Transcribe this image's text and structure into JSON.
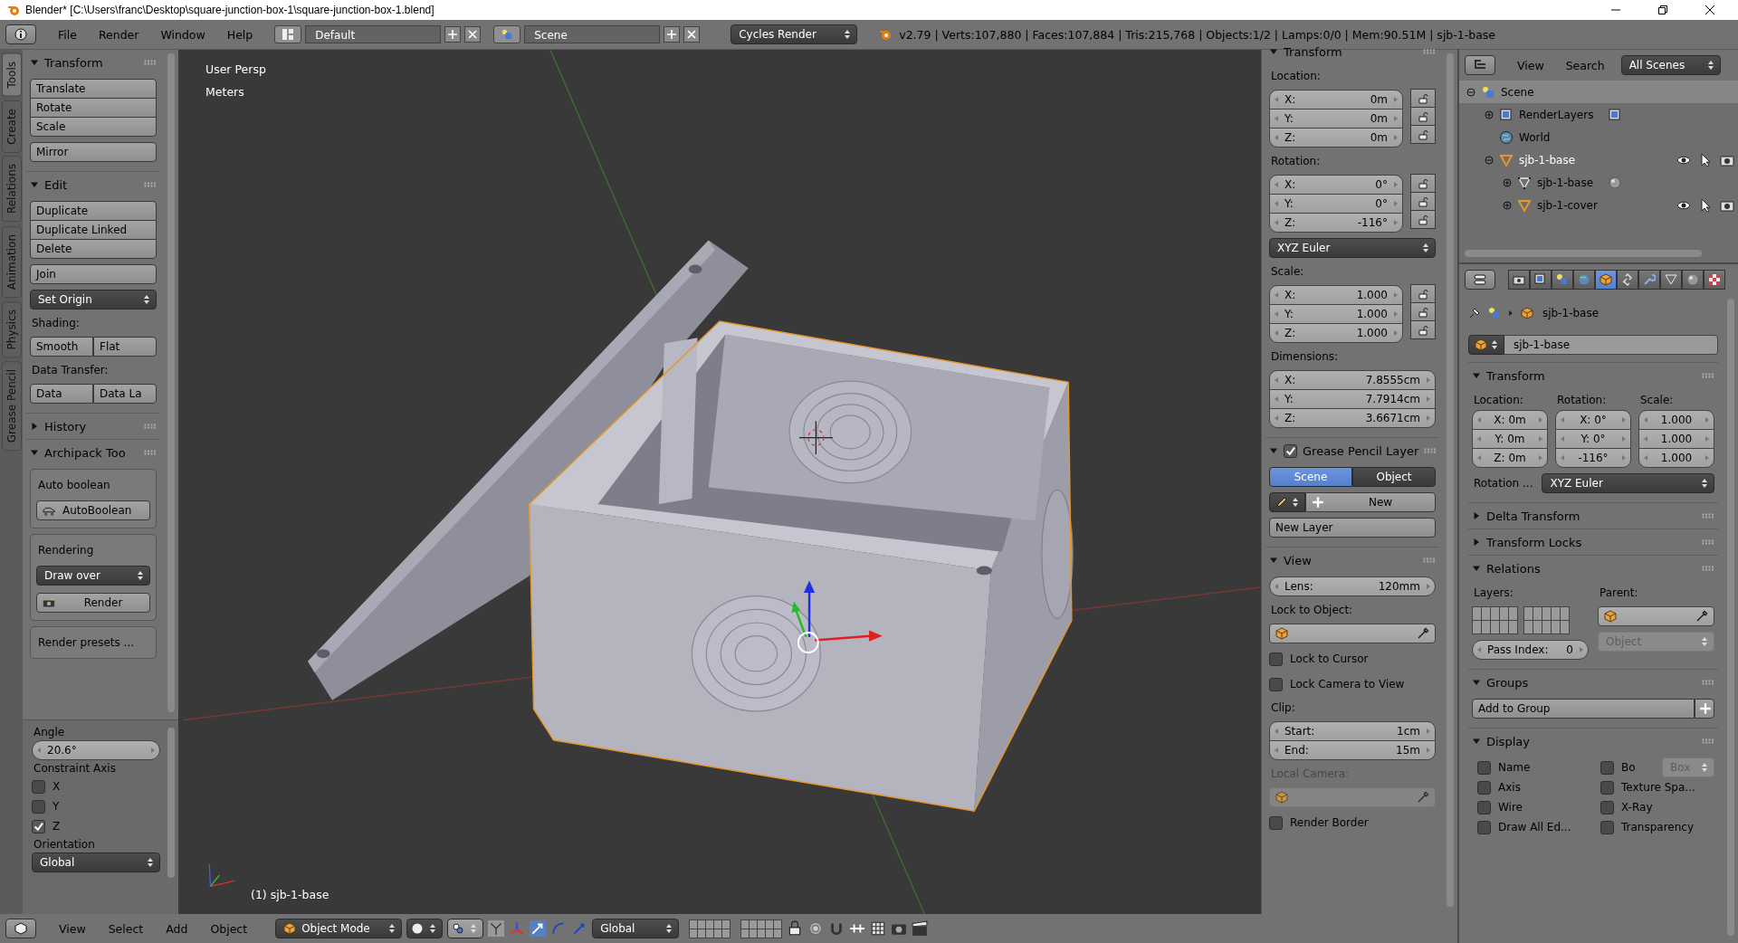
{
  "title_bar": {
    "title": "Blender* [C:\\Users\\franc\\Desktop\\square-junction-box-1\\square-junction-box-1.blend]"
  },
  "info_header": {
    "menus": [
      "File",
      "Render",
      "Window",
      "Help"
    ],
    "screen_layout": "Default",
    "scene": "Scene",
    "render_engine": "Cycles Render",
    "stats": "v2.79 | Verts:107,880 | Faces:107,884 | Tris:215,768 | Objects:1/2 | Lamps:0/0 | Mem:90.51M | sjb-1-base"
  },
  "tool_tabs": [
    {
      "label": "Tools",
      "selected": true
    },
    {
      "label": "Create",
      "selected": false
    },
    {
      "label": "Relations",
      "selected": false
    },
    {
      "label": "Animation",
      "selected": false
    },
    {
      "label": "Physics",
      "selected": false
    },
    {
      "label": "Grease Pencil",
      "selected": false
    }
  ],
  "tool_shelf": {
    "panels": [
      {
        "title": "Transform",
        "expanded": true,
        "items": [
          {
            "kind": "column",
            "labels": [
              "Translate",
              "Rotate",
              "Scale"
            ]
          },
          {
            "kind": "button",
            "label": "Mirror"
          }
        ]
      },
      {
        "title": "Edit",
        "expanded": true,
        "items": [
          {
            "kind": "column",
            "labels": [
              "Duplicate",
              "Duplicate Linked",
              "Delete"
            ]
          },
          {
            "kind": "button",
            "label": "Join"
          },
          {
            "kind": "dropdown",
            "value": "Set Origin",
            "disabled": false
          },
          {
            "kind": "label",
            "text": "Shading:",
            "disabled": false
          },
          {
            "kind": "row",
            "labels": [
              "Smooth",
              "Flat"
            ]
          },
          {
            "kind": "label",
            "text": "Data Transfer:",
            "disabled": false
          },
          {
            "kind": "row",
            "labels": [
              "Data",
              "Data La"
            ]
          }
        ]
      },
      {
        "title": "History",
        "expanded": false
      },
      {
        "title": "Archipack Too",
        "expanded": true,
        "items": [
          {
            "kind": "box",
            "items": [
              {
                "kind": "label",
                "text": "Auto boolean",
                "disabled": false
              },
              {
                "kind": "boolean_button",
                "label": "AutoBoolean"
              }
            ]
          },
          {
            "kind": "box",
            "items": [
              {
                "kind": "label",
                "text": "Rendering",
                "disabled": false
              },
              {
                "kind": "dropdown",
                "value": "Draw over",
                "disabled": false
              },
              {
                "kind": "render_button",
                "label": "Render"
              }
            ]
          },
          {
            "kind": "box",
            "items": [
              {
                "kind": "label",
                "text": "Render presets ...",
                "disabled": false
              }
            ]
          }
        ]
      }
    ]
  },
  "operator_panel": {
    "items": [
      {
        "kind": "label",
        "text": "Angle",
        "disabled": false
      },
      {
        "kind": "number",
        "value": "20.6°"
      },
      {
        "kind": "label",
        "text": "Constraint Axis",
        "disabled": false
      },
      {
        "kind": "checkbox",
        "label": "X",
        "checked": false
      },
      {
        "kind": "checkbox",
        "label": "Y",
        "checked": false
      },
      {
        "kind": "checkbox",
        "label": "Z",
        "checked": true
      },
      {
        "kind": "label",
        "text": "Orientation",
        "disabled": false
      },
      {
        "kind": "dropdown",
        "value": "Global",
        "disabled": false
      }
    ]
  },
  "viewport": {
    "view_name": "User Persp",
    "units": "Meters",
    "object_label": "(1) sjb-1-base"
  },
  "n_panel": {
    "panels": [
      {
        "title": "Transform",
        "expanded": true,
        "items": [
          {
            "kind": "label",
            "text": "Location:",
            "disabled": false
          },
          {
            "kind": "fields",
            "locks": true,
            "fields": [
              {
                "label": "X:",
                "value": "0m"
              },
              {
                "label": "Y:",
                "value": "0m"
              },
              {
                "label": "Z:",
                "value": "0m"
              }
            ]
          },
          {
            "kind": "label",
            "text": "Rotation:",
            "disabled": false
          },
          {
            "kind": "fields",
            "locks": true,
            "fields": [
              {
                "label": "X:",
                "value": "0°"
              },
              {
                "label": "Y:",
                "value": "0°"
              },
              {
                "label": "Z:",
                "value": "-116°"
              }
            ]
          },
          {
            "kind": "dropdown",
            "value": "XYZ Euler",
            "disabled": false
          },
          {
            "kind": "label",
            "text": "Scale:",
            "disabled": false
          },
          {
            "kind": "fields",
            "locks": true,
            "fields": [
              {
                "label": "X:",
                "value": "1.000"
              },
              {
                "label": "Y:",
                "value": "1.000"
              },
              {
                "label": "Z:",
                "value": "1.000"
              }
            ]
          },
          {
            "kind": "label",
            "text": "Dimensions:",
            "disabled": false
          },
          {
            "kind": "fields",
            "locks": false,
            "fields": [
              {
                "label": "X:",
                "value": "7.8555cm"
              },
              {
                "label": "Y:",
                "value": "7.7914cm"
              },
              {
                "label": "Z:",
                "value": "3.6671cm"
              }
            ]
          }
        ]
      },
      {
        "title": "Grease Pencil Layer",
        "expanded": true,
        "checked": true,
        "items": [
          {
            "kind": "segmented",
            "options": [
              {
                "label": "Scene",
                "selected": true
              },
              {
                "label": "Object",
                "selected": false
              }
            ]
          },
          {
            "kind": "pencil_new",
            "label": "New"
          },
          {
            "kind": "button",
            "label": "New Layer"
          }
        ]
      },
      {
        "title": "View",
        "expanded": true,
        "items": [
          {
            "kind": "number",
            "label": "Lens:",
            "value": "120mm"
          },
          {
            "kind": "label",
            "text": "Lock to Object:",
            "disabled": false
          },
          {
            "kind": "picker",
            "disabled": false
          },
          {
            "kind": "checkbox",
            "label": "Lock to Cursor",
            "checked": false
          },
          {
            "kind": "checkbox",
            "label": "Lock Camera to View",
            "checked": false
          },
          {
            "kind": "label",
            "text": "Clip:",
            "disabled": false
          },
          {
            "kind": "fields",
            "locks": false,
            "fields": [
              {
                "label": "Start:",
                "value": "1cm"
              },
              {
                "label": "End:",
                "value": "15m"
              }
            ]
          },
          {
            "kind": "label",
            "text": "Local Camera:",
            "disabled": true
          },
          {
            "kind": "picker",
            "disabled": true
          },
          {
            "kind": "checkbox",
            "label": "Render Border",
            "checked": false
          }
        ]
      }
    ]
  },
  "outliner": {
    "menus": [
      "View",
      "Search"
    ],
    "filter": "All Scenes",
    "tree": [
      {
        "name": "Scene",
        "kind": "scene",
        "expanded": true,
        "selected": true,
        "active": false,
        "toggles": false,
        "children": [
          {
            "name": "RenderLayers",
            "kind": "renderlayers",
            "expanded": false,
            "selected": false,
            "active": false,
            "toggles": false
          },
          {
            "name": "World",
            "kind": "world",
            "selected": false,
            "active": false,
            "toggles": false
          },
          {
            "name": "sjb-1-base",
            "kind": "object",
            "expanded": true,
            "selected": false,
            "active": true,
            "toggles": true,
            "children": [
              {
                "name": "sjb-1-base",
                "kind": "mesh",
                "expanded": false,
                "selected": false,
                "active": false,
                "toggles": false
              },
              {
                "name": "sjb-1-cover",
                "kind": "object",
                "expanded": false,
                "selected": false,
                "active": false,
                "toggles": true
              }
            ]
          }
        ]
      }
    ]
  },
  "properties": {
    "tabs": [
      {
        "kind": "render",
        "selected": false
      },
      {
        "kind": "render_layers",
        "selected": false
      },
      {
        "kind": "scene",
        "selected": false
      },
      {
        "kind": "world",
        "selected": false
      },
      {
        "kind": "object",
        "selected": true
      },
      {
        "kind": "constraints",
        "selected": false
      },
      {
        "kind": "modifiers",
        "selected": false
      },
      {
        "kind": "data",
        "selected": false
      },
      {
        "kind": "material",
        "selected": false
      },
      {
        "kind": "texture",
        "selected": false
      }
    ],
    "breadcrumb": "sjb-1-base",
    "object_name": "sjb-1-base",
    "panels": [
      {
        "title": "Transform",
        "expanded": true,
        "items": [
          {
            "kind": "columns",
            "columns": [
              {
                "label": "Location:",
                "fields": [
                  "X: 0m",
                  "Y: 0m",
                  "Z: 0m"
                ]
              },
              {
                "label": "Rotation:",
                "fields": [
                  "X:  0°",
                  "Y:  0°",
                  "-116°"
                ]
              },
              {
                "label": "Scale:",
                "fields": [
                  "1.000",
                  "1.000",
                  "1.000"
                ]
              }
            ]
          },
          {
            "kind": "labeled_dropdown",
            "label": "Rotation ...",
            "value": "XYZ Euler"
          }
        ]
      },
      {
        "title": "Delta Transform",
        "expanded": false
      },
      {
        "title": "Transform Locks",
        "expanded": false
      },
      {
        "title": "Relations",
        "expanded": true,
        "items": [
          {
            "kind": "two_col",
            "left": [
              {
                "kind": "label",
                "text": "Layers:",
                "disabled": false
              },
              {
                "kind": "layer_grids"
              },
              {
                "kind": "number",
                "label": "Pass Index:",
                "value": "0"
              }
            ],
            "right": [
              {
                "kind": "label",
                "text": "Parent:",
                "disabled": false
              },
              {
                "kind": "picker",
                "disabled": false
              },
              {
                "kind": "dropdown",
                "value": "Object",
                "disabled": true
              }
            ]
          }
        ]
      },
      {
        "title": "Groups",
        "expanded": true,
        "items": [
          {
            "kind": "add_button",
            "label": "Add to Group"
          }
        ]
      },
      {
        "title": "Display",
        "expanded": true,
        "items": [
          {
            "kind": "grid2",
            "cells": [
              {
                "kind": "checkbox",
                "label": "Name",
                "checked": false
              },
              {
                "kind": "checkbox_dropdown",
                "label": "Bo",
                "checked": false,
                "value": "Box",
                "disabled": true
              },
              {
                "kind": "checkbox",
                "label": "Axis",
                "checked": false
              },
              {
                "kind": "checkbox",
                "label": "Texture Spa...",
                "checked": false
              },
              {
                "kind": "checkbox",
                "label": "Wire",
                "checked": false
              },
              {
                "kind": "checkbox",
                "label": "X-Ray",
                "checked": false
              },
              {
                "kind": "checkbox",
                "label": "Draw All Ed...",
                "checked": false
              },
              {
                "kind": "checkbox",
                "label": "Transparency",
                "checked": false
              }
            ]
          }
        ]
      }
    ]
  },
  "view3d_header": {
    "menus": [
      "View",
      "Select",
      "Add",
      "Object"
    ],
    "mode": "Object Mode",
    "orientation": "Global"
  }
}
